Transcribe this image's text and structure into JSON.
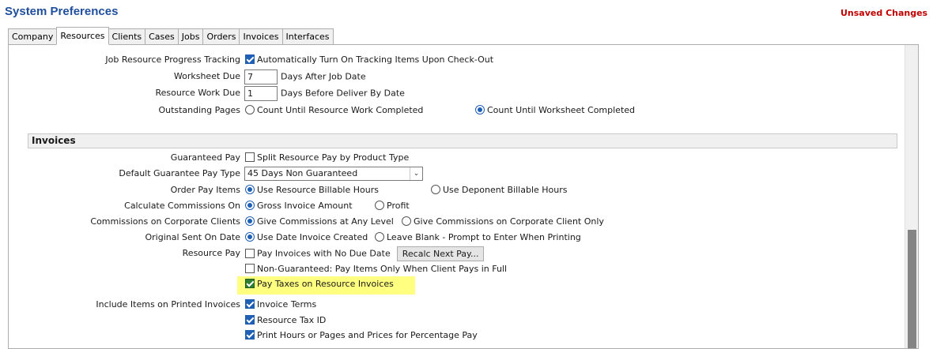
{
  "window": {
    "title": "System Preferences",
    "unsaved": "Unsaved Changes"
  },
  "tabs": [
    {
      "label": "Company"
    },
    {
      "label": "Resources"
    },
    {
      "label": "Clients"
    },
    {
      "label": "Cases"
    },
    {
      "label": "Jobs"
    },
    {
      "label": "Orders"
    },
    {
      "label": "Invoices"
    },
    {
      "label": "Interfaces"
    }
  ],
  "active_tab": "Resources",
  "resources": {
    "tracking_label": "Job Resource Progress Tracking",
    "tracking_option": "Automatically Turn On Tracking Items Upon Check-Out",
    "worksheet_label": "Worksheet Due",
    "worksheet_value": "7",
    "worksheet_suffix": "Days After Job Date",
    "workdue_label": "Resource Work Due",
    "workdue_value": "1",
    "workdue_suffix": "Days Before Deliver By Date",
    "outstanding_label": "Outstanding Pages",
    "outstanding_opt1": "Count Until Resource Work Completed",
    "outstanding_opt2": "Count Until Worksheet Completed"
  },
  "invoices": {
    "section_title": "Invoices",
    "guaranteed_label": "Guaranteed Pay",
    "guaranteed_option": "Split Resource Pay by Product Type",
    "default_guarantee_label": "Default Guarantee Pay Type",
    "default_guarantee_value": "45 Days Non Guaranteed",
    "order_pay_label": "Order Pay Items",
    "order_pay_opt1": "Use Resource Billable Hours",
    "order_pay_opt2": "Use Deponent Billable Hours",
    "calc_comm_label": "Calculate Commissions On",
    "calc_comm_opt1": "Gross Invoice Amount",
    "calc_comm_opt2": "Profit",
    "corp_comm_label": "Commissions on Corporate Clients",
    "corp_comm_opt1": "Give Commissions at Any Level",
    "corp_comm_opt2": "Give Commissions on Corporate Client Only",
    "orig_sent_label": "Original Sent On Date",
    "orig_sent_opt1": "Use Date Invoice Created",
    "orig_sent_opt2": "Leave Blank - Prompt to Enter When Printing",
    "resource_pay_label": "Resource Pay",
    "resource_pay_opt1": "Pay Invoices with No Due Date",
    "recalc_button": "Recalc Next Pay...",
    "resource_pay_opt2": "Non-Guaranteed: Pay Items Only When Client Pays in Full",
    "resource_pay_opt3": "Pay Taxes on Resource Invoices",
    "include_label": "Include Items on Printed Invoices",
    "include_opt1": "Invoice Terms",
    "include_opt2": "Resource Tax ID",
    "include_opt3": "Print Hours or Pages and Prices for Percentage Pay"
  },
  "colors": {
    "title": "#1f4e9c",
    "unsaved": "#c00000",
    "accent": "#1f5fb4",
    "highlight": "#ffff80",
    "check_green": "#2e7d32"
  }
}
